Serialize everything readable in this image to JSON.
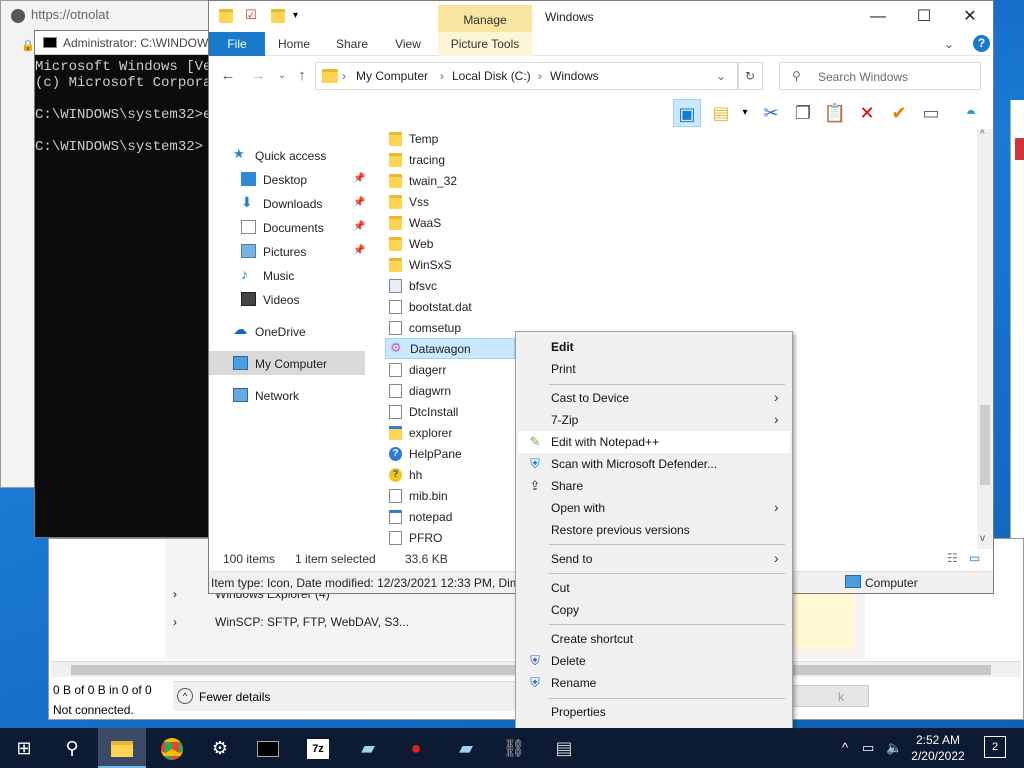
{
  "browser": {
    "url": "https://otnolat"
  },
  "cmd": {
    "title": "Administrator: C:\\WINDOWS",
    "lines": [
      "Microsoft Windows [Ver",
      "(c) Microsoft Corporat",
      "",
      "C:\\WINDOWS\\system32>ex",
      "",
      "C:\\WINDOWS\\system32>"
    ]
  },
  "explorer": {
    "window_title": "Windows",
    "manage_label": "Manage",
    "tabs": {
      "file": "File",
      "home": "Home",
      "share": "Share",
      "view": "View",
      "picture_tools": "Picture Tools"
    },
    "address": {
      "crumbs": [
        "My Computer",
        "Local Disk (C:)",
        "Windows"
      ]
    },
    "search": {
      "placeholder": "Search Windows"
    },
    "nav": {
      "quick_access": "Quick access",
      "desktop": "Desktop",
      "downloads": "Downloads",
      "documents": "Documents",
      "pictures": "Pictures",
      "music": "Music",
      "videos": "Videos",
      "onedrive": "OneDrive",
      "mycomputer": "My Computer",
      "network": "Network"
    },
    "files": [
      {
        "name": "Temp"
      },
      {
        "name": "tracing"
      },
      {
        "name": "twain_32"
      },
      {
        "name": "Vss"
      },
      {
        "name": "WaaS"
      },
      {
        "name": "Web"
      },
      {
        "name": "WinSxS"
      },
      {
        "name": "bfsvc"
      },
      {
        "name": "bootstat.dat"
      },
      {
        "name": "comsetup"
      },
      {
        "name": "Datawagon"
      },
      {
        "name": "diagerr"
      },
      {
        "name": "diagwrn"
      },
      {
        "name": "DtcInstall"
      },
      {
        "name": "explorer"
      },
      {
        "name": "HelpPane"
      },
      {
        "name": "hh"
      },
      {
        "name": "mib.bin"
      },
      {
        "name": "notepad"
      },
      {
        "name": "PFRO"
      }
    ],
    "status": {
      "count": "100 items",
      "selected": "1 item selected",
      "size": "33.6 KB"
    },
    "info": {
      "details": "Item type: Icon, Date modified: 12/23/2021 12:33 PM, Dime",
      "location": "Computer"
    }
  },
  "context_menu": {
    "edit": "Edit",
    "print": "Print",
    "cast": "Cast to Device",
    "zip": "7-Zip",
    "notepadpp": "Edit with Notepad++",
    "defender": "Scan with Microsoft Defender...",
    "share": "Share",
    "open_with": "Open with",
    "restore": "Restore previous versions",
    "send_to": "Send to",
    "cut": "Cut",
    "copy": "Copy",
    "create_shortcut": "Create shortcut",
    "delete": "Delete",
    "rename": "Rename",
    "properties": "Properties"
  },
  "lower_window": {
    "proc1": "Windows Explorer (4)",
    "proc2": "WinSCP: SFTP, FTP, WebDAV, S3...",
    "status1": "0 B of 0 B in 0 of 0",
    "status2": "Not connected.",
    "fewer_details": "Fewer details"
  },
  "taskbar": {
    "time": "2:52 AM",
    "date": "2/20/2022",
    "notifications": "2"
  },
  "colors": {
    "accent": "#1979ca",
    "selection": "#cce8ff",
    "taskbar": "#0d1a33"
  }
}
